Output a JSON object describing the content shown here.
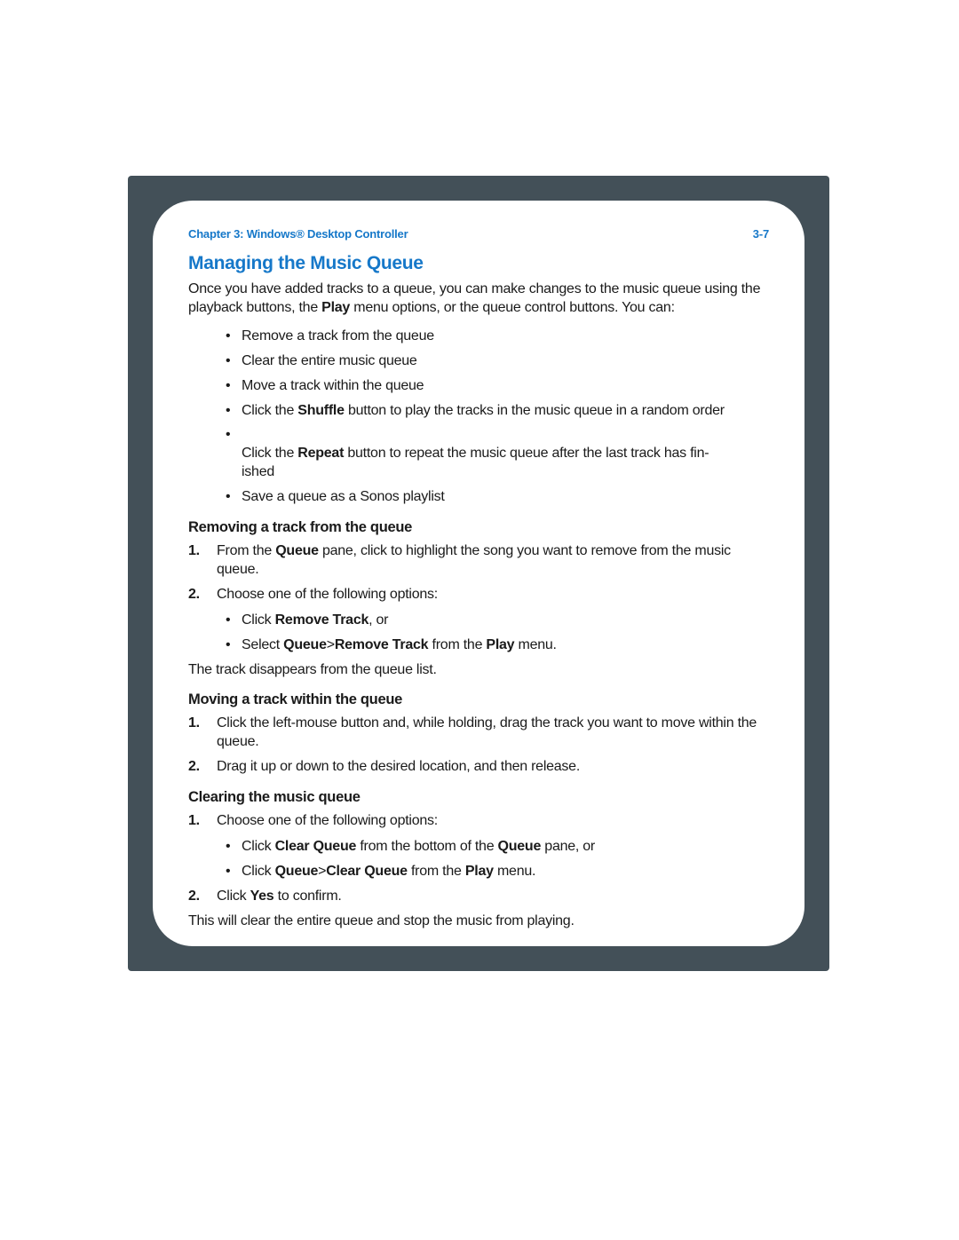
{
  "header": {
    "chapter": "Chapter 3:  Windows® Desktop Controller",
    "page_number": "3-7"
  },
  "h1": "Managing the Music Queue",
  "intro": {
    "pre": "Once you have added tracks to a queue, you can make changes to the music queue using the playback buttons, the ",
    "bold1": "Play",
    "post": " menu options, or the queue control buttons. You can:"
  },
  "top_bullets": {
    "b1": "Remove a track from the queue",
    "b2": "Clear the entire music queue",
    "b3": "Move a track within the queue",
    "b4": {
      "pre": "Click the ",
      "bold": "Shuffle",
      "post": " button to play the tracks in the music queue in a random order"
    },
    "b5": {
      "pre": "Click the ",
      "bold": "Repeat",
      "post": " button to repeat the music queue after the last track has fin-\nished"
    },
    "b6": "Save a queue as a Sonos playlist"
  },
  "sec_remove": {
    "title": "Removing a track from the queue",
    "s1": {
      "pre": "From the ",
      "bold": "Queue",
      "post": " pane, click to highlight the song you want to remove from the music queue."
    },
    "s2": {
      "text": "Choose one of the following options:",
      "sub1": {
        "pre": "Click ",
        "bold": "Remove Track",
        "post": ", or"
      },
      "sub2": {
        "pre": "Select ",
        "b1": "Queue",
        "gt": ">",
        "b2": "Remove Track",
        "mid": " from the ",
        "b3": "Play",
        "post": " menu."
      }
    },
    "closing": "The track disappears from the queue list."
  },
  "sec_move": {
    "title": "Moving a track within the queue",
    "s1": "Click the left-mouse button and, while holding, drag the track you want to move within the queue.",
    "s2": "Drag it up or down to the desired location, and then release."
  },
  "sec_clear": {
    "title": "Clearing the music queue",
    "s1": {
      "text": "Choose one of the following options:",
      "sub1": {
        "pre": "Click ",
        "b1": "Clear Queue",
        "mid": " from the bottom of the ",
        "b2": "Queue",
        "post": " pane, or"
      },
      "sub2": {
        "pre": "Click ",
        "b1": "Queue",
        "gt": ">",
        "b2": "Clear Queue",
        "mid": " from the ",
        "b3": "Play",
        "post": " menu."
      }
    },
    "s2": {
      "pre": "Click ",
      "bold": "Yes",
      "post": " to confirm."
    },
    "closing": "This will clear the entire queue and stop the music from playing."
  }
}
